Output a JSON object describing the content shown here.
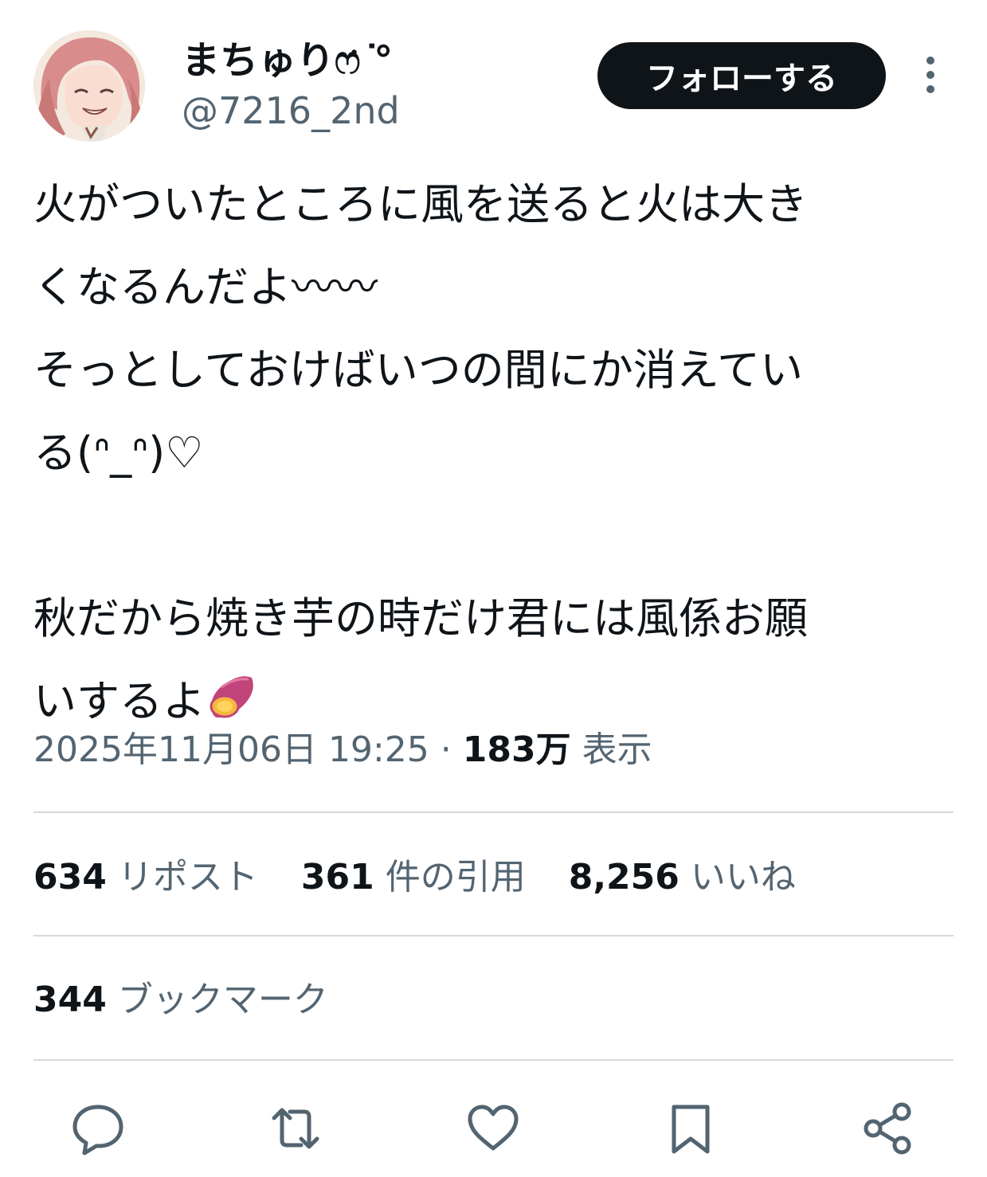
{
  "user": {
    "display_name": "まちゅりෆ̇ ͘͘°",
    "handle": "@7216_2nd",
    "avatar_icon": "anime-girl-avatar"
  },
  "follow_button": {
    "label": "フォローする"
  },
  "tweet": {
    "lines": [
      "火がついたところに風を送ると火は大き",
      "くなるんだよ〰︎〰︎",
      "そっとしておけばいつの間にか消えてい",
      "る(ᐢ_ᐢ)♡",
      "",
      "秋だから焼き芋の時だけ君には風係お願",
      "いするよ"
    ],
    "emoji_icon": "sweet-potato-icon"
  },
  "meta": {
    "timestamp": "2025年11月06日 19:25",
    "separator": "·",
    "views_count": "183万",
    "views_label": "表示"
  },
  "stats": {
    "reposts_count": "634",
    "reposts_label": "リポスト",
    "quotes_count": "361",
    "quotes_label": "件の引用",
    "likes_count": "8,256",
    "likes_label": "いいね",
    "bookmarks_count": "344",
    "bookmarks_label": "ブックマーク"
  },
  "actions": [
    "reply-icon",
    "retweet-icon",
    "like-icon",
    "bookmark-icon",
    "share-icon"
  ],
  "colors": {
    "primary_text": "#0f1419",
    "secondary_text": "#536471",
    "divider": "#d9d9d9",
    "follow_bg": "#0f1419",
    "follow_text": "#ffffff"
  }
}
